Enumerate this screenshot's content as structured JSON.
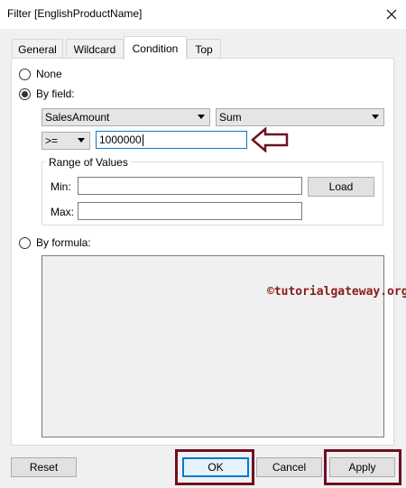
{
  "window": {
    "title": "Filter [EnglishProductName]",
    "close_icon": "close-icon"
  },
  "tabs": [
    {
      "label": "General",
      "active": false
    },
    {
      "label": "Wildcard",
      "active": false
    },
    {
      "label": "Condition",
      "active": true
    },
    {
      "label": "Top",
      "active": false
    }
  ],
  "condition": {
    "none_label": "None",
    "by_field_label": "By field:",
    "selected_option": "By field:",
    "field": "SalesAmount",
    "aggregation": "Sum",
    "operator": ">=",
    "value": "1000000",
    "range": {
      "title": "Range of Values",
      "min_label": "Min:",
      "min_value": "",
      "max_label": "Max:",
      "max_value": "",
      "load_label": "Load"
    },
    "by_formula_label": "By formula:",
    "formula_text": ""
  },
  "watermark": "©tutorialgateway.org",
  "buttons": {
    "reset": "Reset",
    "ok": "OK",
    "cancel": "Cancel",
    "apply": "Apply"
  },
  "colors": {
    "highlight": "#6e1023",
    "focus": "#0078d7",
    "watermark": "#8b1a1a"
  }
}
